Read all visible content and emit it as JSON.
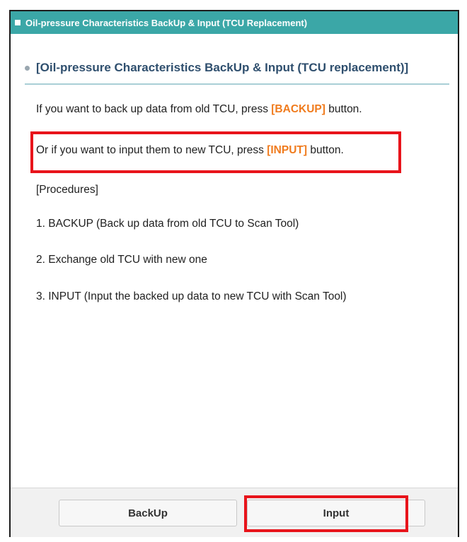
{
  "window": {
    "title": "Oil-pressure Characteristics BackUp & Input (TCU Replacement)"
  },
  "section": {
    "heading": "[Oil-pressure Characteristics BackUp & Input (TCU replacement)]"
  },
  "content": {
    "line1_pre": "If you want to back up data from old TCU, press ",
    "line1_accent": "[BACKUP]",
    "line1_post": " button.",
    "line2_pre": "Or if you want to input them to new TCU, press ",
    "line2_accent": "[INPUT]",
    "line2_post": " button.",
    "procedures_label": "[Procedures]",
    "step1": "1. BACKUP (Back up data from old TCU to Scan Tool)",
    "step2": "2. Exchange old TCU with new one",
    "step3": "3. INPUT (Input the backed up data to new TCU with Scan Tool)"
  },
  "footer": {
    "backup_label": "BackUp",
    "input_label": "Input"
  },
  "colors": {
    "titlebar": "#3ba7a7",
    "heading": "#2f4f6e",
    "accent": "#f07b1d",
    "highlight": "#e8141b"
  },
  "icons": {
    "title_marker": "square-icon",
    "heading_marker": "bullet-dot-icon"
  }
}
